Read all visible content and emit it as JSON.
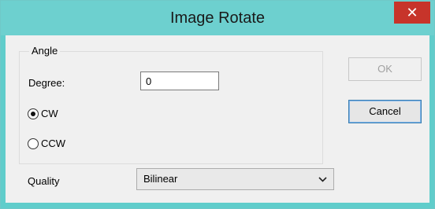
{
  "window": {
    "title": "Image Rotate",
    "close_glyph": "✕",
    "titlebar_color": "#6dd0cf",
    "close_color": "#c7342a"
  },
  "angle_group": {
    "title": "Angle",
    "degree_label": "Degree:",
    "degree_value": "0",
    "direction_options": [
      {
        "label": "CW",
        "selected": true
      },
      {
        "label": "CCW",
        "selected": false
      }
    ]
  },
  "quality": {
    "label": "Quality",
    "selected": "Bilinear",
    "icon": "chevron-down-icon"
  },
  "buttons": {
    "ok_label": "OK",
    "ok_enabled": false,
    "cancel_label": "Cancel"
  }
}
